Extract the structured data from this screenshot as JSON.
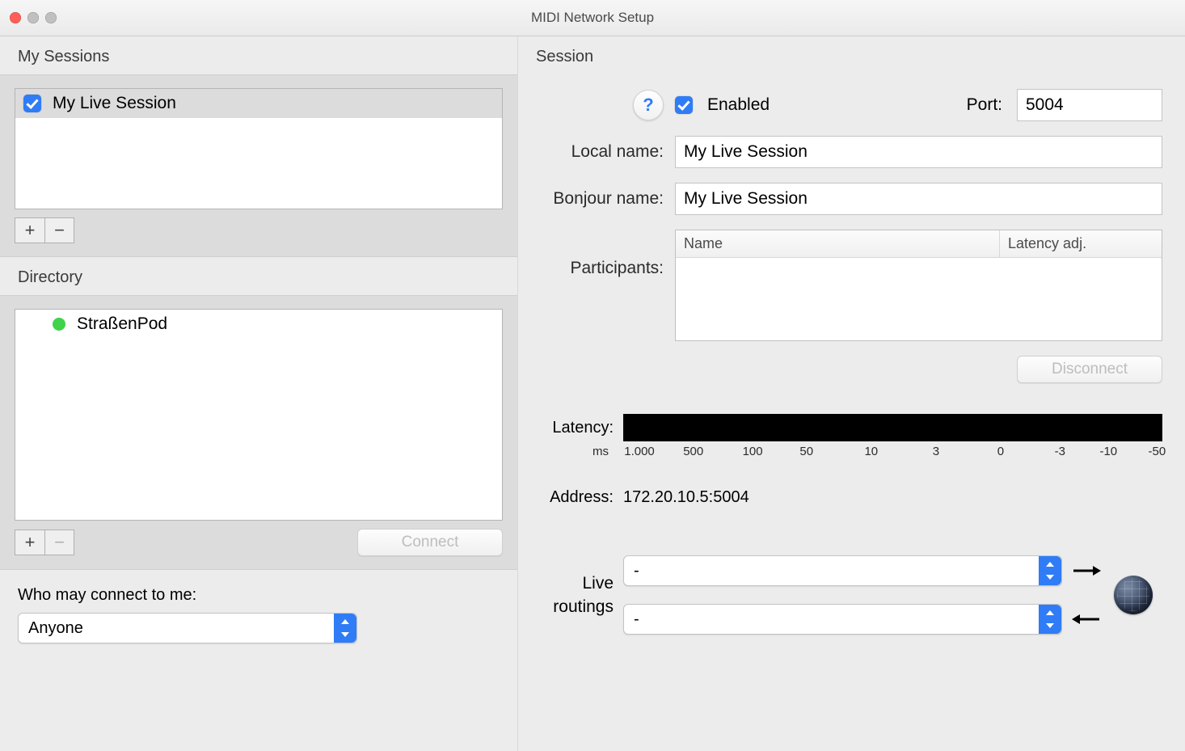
{
  "window": {
    "title": "MIDI Network Setup"
  },
  "left": {
    "mySessionsHeader": "My Sessions",
    "sessions": [
      {
        "label": "My Live Session",
        "checked": true
      }
    ],
    "directoryHeader": "Directory",
    "directory": [
      {
        "label": "StraßenPod"
      }
    ],
    "connectButton": "Connect",
    "whoLabel": "Who may connect to me:",
    "whoValue": "Anyone"
  },
  "right": {
    "header": "Session",
    "helpGlyph": "?",
    "enabledLabel": "Enabled",
    "portLabel": "Port:",
    "portValue": "5004",
    "localNameLabel": "Local name:",
    "localNameValue": "My Live Session",
    "bonjourLabel": "Bonjour name:",
    "bonjourValue": "My Live Session",
    "participantsLabel": "Participants:",
    "participantsCols": {
      "name": "Name",
      "latency": "Latency adj."
    },
    "disconnectButton": "Disconnect",
    "latencyLabel": "Latency:",
    "latencyUnit": "ms",
    "latencyTicks": [
      "1.000",
      "500",
      "100",
      "50",
      "10",
      "3",
      "0",
      "-3",
      "-10",
      "-50"
    ],
    "addressLabel": "Address:",
    "addressValue": "172.20.10.5:5004",
    "routingLabel1": "Live",
    "routingLabel2": "routings",
    "routing1": "-",
    "routing2": "-"
  }
}
